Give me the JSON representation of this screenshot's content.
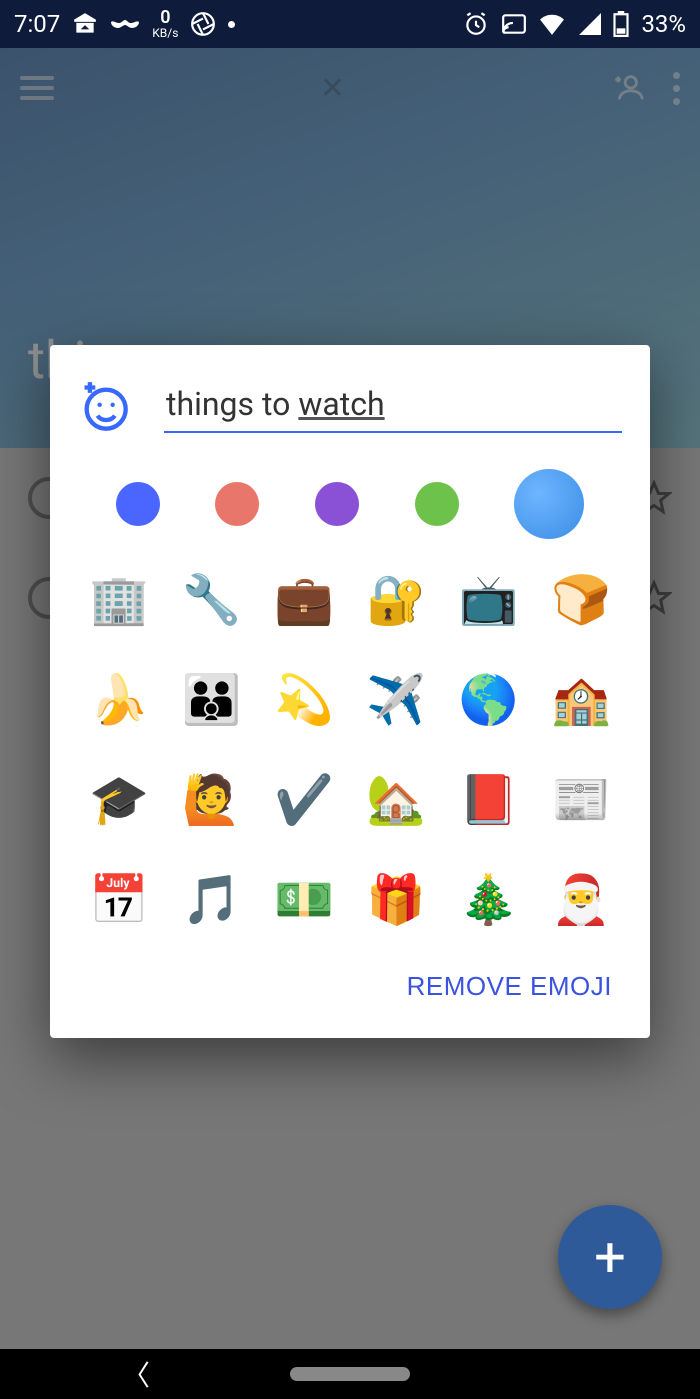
{
  "status": {
    "time": "7:07",
    "network_speed": {
      "value": "0",
      "unit": "KB/s"
    },
    "battery_percent": "33%",
    "icons_left": [
      "inbox-icon",
      "mustache-icon",
      "speed-icon",
      "aperture-icon",
      "dot-icon"
    ],
    "icons_right": [
      "alarm-icon",
      "cast-icon",
      "wifi-icon",
      "signal-icon",
      "battery-icon"
    ]
  },
  "background": {
    "list_title_partial": "thi"
  },
  "dialog": {
    "input_value": "things to watch",
    "input_underlined_word": "watch",
    "colors": [
      {
        "name": "blue",
        "hex": "#4a66ff",
        "selected": false
      },
      {
        "name": "coral",
        "hex": "#e9766a",
        "selected": false
      },
      {
        "name": "purple",
        "hex": "#8a50d6",
        "selected": false
      },
      {
        "name": "green",
        "hex": "#6cc24a",
        "selected": false
      },
      {
        "name": "sky",
        "hex": "#4aa3e8",
        "selected": true
      }
    ],
    "emojis": [
      {
        "name": "office-building",
        "char": "🏢"
      },
      {
        "name": "wrench",
        "char": "🔧"
      },
      {
        "name": "briefcase",
        "char": "💼"
      },
      {
        "name": "locked-key",
        "char": "🔐"
      },
      {
        "name": "television",
        "char": "📺"
      },
      {
        "name": "bread",
        "char": "🍞"
      },
      {
        "name": "banana",
        "char": "🍌"
      },
      {
        "name": "family",
        "char": "👪"
      },
      {
        "name": "dizzy-star",
        "char": "💫"
      },
      {
        "name": "airplane",
        "char": "✈️"
      },
      {
        "name": "globe",
        "char": "🌎"
      },
      {
        "name": "school",
        "char": "🏫"
      },
      {
        "name": "graduation-cap",
        "char": "🎓"
      },
      {
        "name": "raising-hand",
        "char": "🙋"
      },
      {
        "name": "check-mark",
        "char": "✔️"
      },
      {
        "name": "house-garden",
        "char": "🏡"
      },
      {
        "name": "notebook",
        "char": "📕"
      },
      {
        "name": "newspaper",
        "char": "📰"
      },
      {
        "name": "calendar",
        "char": "📅"
      },
      {
        "name": "music-note",
        "char": "🎵"
      },
      {
        "name": "money",
        "char": "💵"
      },
      {
        "name": "gift",
        "char": "🎁"
      },
      {
        "name": "christmas-tree",
        "char": "🎄"
      },
      {
        "name": "santa",
        "char": "🎅"
      }
    ],
    "remove_label": "REMOVE EMOJI"
  },
  "fab": {
    "label": "+"
  }
}
